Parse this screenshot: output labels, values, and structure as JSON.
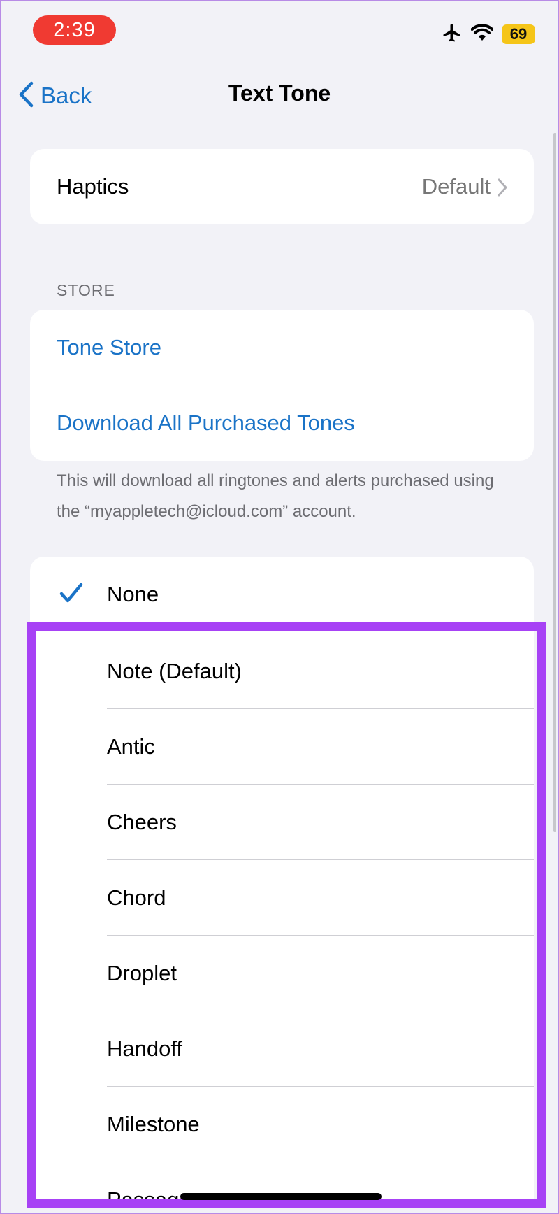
{
  "status_bar": {
    "time": "2:39",
    "battery": "69",
    "icons": [
      "airplane-icon",
      "wifi-icon",
      "battery-icon"
    ]
  },
  "nav": {
    "back_label": "Back",
    "title": "Text Tone"
  },
  "haptics": {
    "label": "Haptics",
    "value": "Default"
  },
  "store": {
    "header": "STORE",
    "items": [
      "Tone Store",
      "Download All Purchased Tones"
    ],
    "footer": "This will download all ringtones and alerts purchased using the “myappletech@icloud.com” account."
  },
  "tones": {
    "selected": "None",
    "items": [
      "None",
      "Note (Default)",
      "Antic",
      "Cheers",
      "Chord",
      "Droplet",
      "Handoff",
      "Milestone",
      "Passage"
    ]
  },
  "colors": {
    "accent": "#1a73c7",
    "highlight": "#a742f5",
    "time_pill": "#f03a32",
    "battery": "#f5c518"
  }
}
